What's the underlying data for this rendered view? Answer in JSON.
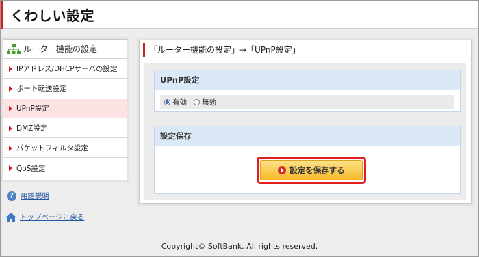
{
  "header": {
    "title": "くわしい設定"
  },
  "sidebar": {
    "heading": "ルーター機能の設定",
    "items": [
      {
        "label": "IPアドレス/DHCPサーバの設定"
      },
      {
        "label": "ポート転送設定"
      },
      {
        "label": "UPnP設定"
      },
      {
        "label": "DMZ設定"
      },
      {
        "label": "パケットフィルタ設定"
      },
      {
        "label": "QoS設定"
      }
    ],
    "active_index": 2
  },
  "links": {
    "glossary": "用語説明",
    "top_page": "トップページに戻る"
  },
  "main": {
    "breadcrumb": "「ルーター機能の設定」→「UPnP設定」",
    "upnp_section": {
      "title": "UPnP設定",
      "options": [
        {
          "label": "有効",
          "selected": true
        },
        {
          "label": "無効",
          "selected": false
        }
      ]
    },
    "save_section": {
      "title": "設定保存",
      "button_label": "設定を保存する"
    }
  },
  "footer": {
    "copyright": "Copyright© SoftBank. All rights reserved."
  },
  "colors": {
    "accent_red": "#d71c1c",
    "section_header_blue": "#dbe8f7",
    "button_yellow": "#f7b928",
    "active_item_pink": "#fde2e4"
  }
}
